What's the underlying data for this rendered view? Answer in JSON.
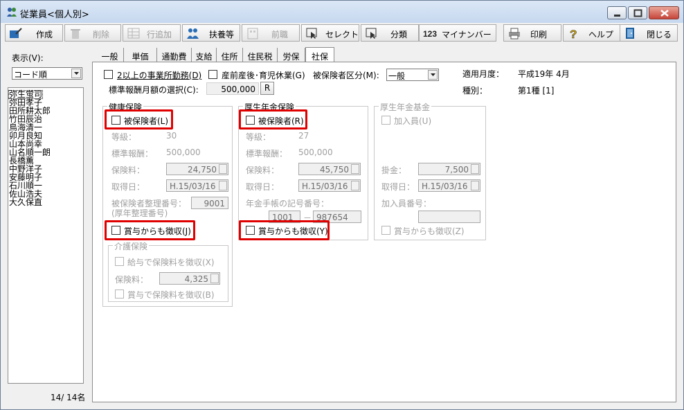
{
  "window": {
    "title": "従業員<個人別>"
  },
  "toolbar": {
    "create": "作成",
    "delete": "削除",
    "add_row": "行追加",
    "dependents": "扶養等",
    "prev_job": "前職",
    "select": "セレクト",
    "classify": "分類",
    "mynumber": "マイナンバー",
    "print": "印刷",
    "help": "ヘルプ",
    "close": "閉じる"
  },
  "left": {
    "display_label": "表示(V):",
    "sort_value": "コード順",
    "employees": [
      "弥生蛍司",
      "弥田孝子",
      "田所耕太郎",
      "竹田辰治",
      "鳥海清一",
      "卯月良知",
      "山本尚幸",
      "山名順一朗",
      "長橋薫",
      "中野洋子",
      "安藤明子",
      "石川順一",
      "佐山浩夫",
      "大久保直"
    ],
    "count": "14/ 14名"
  },
  "tabs": [
    "一般",
    "単価",
    "通勤費",
    "支給",
    "住所",
    "住民税",
    "労保",
    "社保"
  ],
  "top": {
    "multi_office": "2以上の事業所勤務(D)",
    "maternity": "産前産後･育児休業(G)",
    "insured_category_label": "被保険者区分(M):",
    "insured_category_value": "一般",
    "applicable_month_label": "適用月度：",
    "applicable_month_value": "平成19年 4月",
    "standard_select_label": "標準報酬月額の選択(C):",
    "standard_value": "500,000",
    "standard_btn": "R",
    "kind_label": "種別：",
    "kind_value": "第1種 [1]"
  },
  "health": {
    "title": "健康保険",
    "insured": "被保険者(L)",
    "grade_label": "等級：",
    "grade_value": "30",
    "std_label": "標準報酬：",
    "std_value": "500,000",
    "premium_label": "保険料：",
    "premium_value": "24,750",
    "acquired_label": "取得日：",
    "acquired_value": "H.15/03/16",
    "number_label": "被保険者整理番号：",
    "number_sub": "(厚年整理番号)",
    "number_value": "9001",
    "bonus": "賞与からも徴収(J)",
    "care": {
      "title": "介護保険",
      "salary": "給与で保険料を徴収(X)",
      "premium_label": "保険料：",
      "premium_value": "4,325",
      "bonus": "賞与で保険料を徴収(B)"
    }
  },
  "pension": {
    "title": "厚生年金保険",
    "insured": "被保険者(R)",
    "grade_label": "等級：",
    "grade_value": "27",
    "std_label": "標準報酬：",
    "std_value": "500,000",
    "premium_label": "保険料：",
    "premium_value": "45,750",
    "acquired_label": "取得日：",
    "acquired_value": "H.15/03/16",
    "book_label": "年金手帳の記号番号：",
    "book_a": "1001",
    "book_dash": "－",
    "book_b": "987654",
    "bonus": "賞与からも徴収(Y)"
  },
  "fund": {
    "title": "厚生年金基金",
    "member": "加入員(U)",
    "contrib_label": "掛金：",
    "contrib_value": "7,500",
    "acquired_label": "取得日：",
    "acquired_value": "H.15/03/16",
    "member_no_label": "加入員番号：",
    "bonus": "賞与からも徴収(Z)"
  },
  "colors": {
    "highlight": "#e00000",
    "titlebar": "#c6d8ef"
  }
}
